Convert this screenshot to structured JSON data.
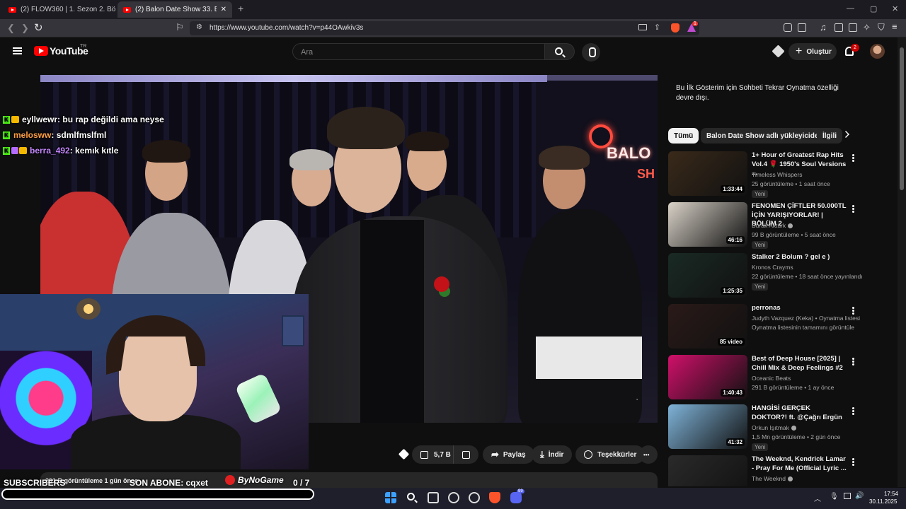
{
  "browser": {
    "tabs": [
      {
        "label": "(2) FLOW360 | 1. Sezon 2. Bölüm | Ş",
        "active": false
      },
      {
        "label": "(2) Balon Date Show 33. Bölüm",
        "active": true
      }
    ],
    "new_tab": "+",
    "url": "https://www.youtube.com/watch?v=p44OAwkiv3s",
    "extension_badge": "1",
    "window_controls": [
      "—",
      "▢",
      "✕"
    ]
  },
  "youtube": {
    "logo_text": "YouTube",
    "country_code": "TR",
    "search_placeholder": "Ara",
    "create_label": "Oluştur",
    "notification_count": "2"
  },
  "video": {
    "neon_text": "BALO",
    "neon_text_2": "SH"
  },
  "chat": {
    "messages": [
      {
        "user": "eyllwewr",
        "text": " : bu rap değildi ama neyse",
        "color": "#ffffff"
      },
      {
        "user": "melosww",
        "text": " : sdmlfmslfml",
        "color": "#ff9f43"
      },
      {
        "user": "berra_492",
        "text": " : kemık kıtle",
        "color": "#c586ff"
      }
    ]
  },
  "actions": {
    "likes": "5,7 B",
    "share": "Paylaş",
    "download": "İndir",
    "thanks": "Teşekkürler",
    "more": "•••"
  },
  "description": {
    "text": "291 B görüntüleme  1 gün önce"
  },
  "sidebar": {
    "chat_replay_note": "Bu İlk Gösterim için Sohbeti Tekrar Oynatma özelliği devre dışı.",
    "chips": [
      "Tümü",
      "Balon Date Show adlı yükleyiciden",
      "İlgili"
    ],
    "recommendations": [
      {
        "title": "1+ Hour of Greatest Rap Hits Vol.4 🌹 1950's Soul Versions ...",
        "channel": "Timeless Whispers",
        "verified": false,
        "meta": "25 görüntüleme • 1 saat önce",
        "badge": "Yeni",
        "duration": "1:33:44",
        "thumb_color": "#3a2a1a"
      },
      {
        "title": "FENOMEN ÇİFTLER 50.000TL İÇİN YARIŞIYORLAR! | BÖLÜM 2",
        "channel": "Burak Aktürk",
        "verified": true,
        "meta": "99 B görüntüleme • 5 saat önce",
        "badge": "Yeni",
        "duration": "46:16",
        "thumb_color": "#d9d2c8"
      },
      {
        "title": "Stalker 2 Bolum ? gel e )",
        "channel": "Kronos Crayms",
        "verified": false,
        "meta": "22 görüntüleme • 18 saat önce yayınlandı",
        "badge": "Yeni",
        "duration": "1:25:35",
        "thumb_color": "#1a2a24"
      },
      {
        "title": "perronas",
        "channel": "Judyth Vazquez (Keka) • Oynatma listesi",
        "verified": false,
        "meta": "Oynatma listesinin tamamını görüntüle",
        "badge": "",
        "duration": "85 video",
        "thumb_color": "#2a1a18"
      },
      {
        "title": "Best of Deep House [2025] | Chill Mix & Deep Feelings #2",
        "channel": "Oceanic Beats",
        "verified": false,
        "meta": "291 B görüntüleme • 1 ay önce",
        "badge": "",
        "duration": "1:40:43",
        "thumb_color": "#d0106a"
      },
      {
        "title": "HANGİSİ GERÇEK DOKTOR?! ft. @Çağrı Ergün",
        "channel": "Orkun Işıtmak",
        "verified": true,
        "meta": "1,5 Mn görüntüleme • 2 gün önce",
        "badge": "Yeni",
        "duration": "41:32",
        "thumb_color": "#7fb3d8"
      },
      {
        "title": "The Weeknd, Kendrick Lamar - Pray For Me (Official Lyric ...",
        "channel": "The Weeknd",
        "verified": true,
        "meta": "",
        "badge": "",
        "duration": "",
        "thumb_color": "#2a2a2a"
      }
    ]
  },
  "stream_overlay": {
    "subscribers_label": "SUBSCRIBERS",
    "last_sub": "SON ABONE: cqxet",
    "sponsor": "ByNoGame",
    "sub_goal_text": "0  / 7",
    "sub_goal_progress": 0
  },
  "taskbar": {
    "time": "17:54",
    "date": "30.11.2025",
    "discord_badge": "99"
  }
}
